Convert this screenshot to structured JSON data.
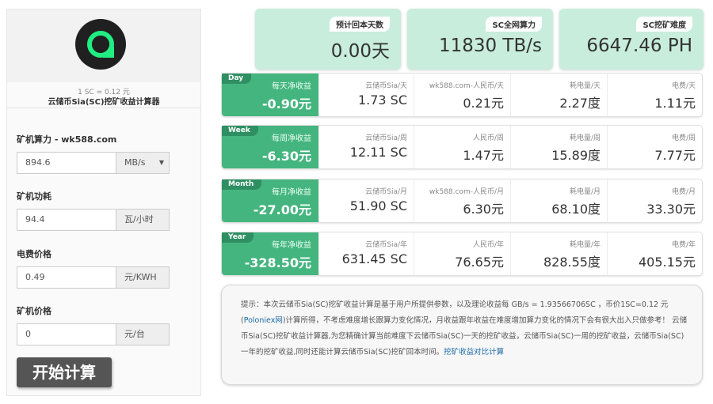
{
  "sidebar": {
    "rate": "1 SC = 0.12 元",
    "title": "云储币Sia(SC)挖矿收益计算器",
    "hashrate": {
      "label": "矿机算力 - wk588.com",
      "value": "894.6",
      "unit": "MB/s"
    },
    "power": {
      "label": "矿机功耗",
      "value": "94.4",
      "unit": "瓦/小时"
    },
    "electricity": {
      "label": "电费价格",
      "value": "0.49",
      "unit": "元/KWH"
    },
    "price": {
      "label": "矿机价格",
      "value": "0",
      "unit": "元/台"
    },
    "start_label": "开始计算"
  },
  "stats": [
    {
      "tag": "预计回本天数",
      "value": "0.00天"
    },
    {
      "tag": "SC全网算力",
      "value": "11830 TB/s"
    },
    {
      "tag": "SC挖矿难度",
      "value": "6647.46 PH"
    }
  ],
  "rows": [
    {
      "period": "Day",
      "net_label": "每天净收益",
      "net_value": "-0.90元",
      "cells": [
        {
          "label": "云储币Sia/天",
          "value": "1.73 SC"
        },
        {
          "label": "wk588.com-人民币/天",
          "value": "0.21元"
        },
        {
          "label": "耗电量/天",
          "value": "2.27度"
        },
        {
          "label": "电费/天",
          "value": "1.11元"
        }
      ]
    },
    {
      "period": "Week",
      "net_label": "每周净收益",
      "net_value": "-6.30元",
      "cells": [
        {
          "label": "云储币Sia/周",
          "value": "12.11 SC"
        },
        {
          "label": "人民币/周",
          "value": "1.47元"
        },
        {
          "label": "耗电量/周",
          "value": "15.89度"
        },
        {
          "label": "电费/周",
          "value": "7.77元"
        }
      ]
    },
    {
      "period": "Month",
      "net_label": "每月净收益",
      "net_value": "-27.00元",
      "cells": [
        {
          "label": "云储币Sia/月",
          "value": "51.90 SC"
        },
        {
          "label": "wk588.com-人民币/月",
          "value": "6.30元"
        },
        {
          "label": "耗电量/月",
          "value": "68.10度"
        },
        {
          "label": "电费/月",
          "value": "33.30元"
        }
      ]
    },
    {
      "period": "Year",
      "net_label": "每年净收益",
      "net_value": "-328.50元",
      "cells": [
        {
          "label": "云储币Sia/年",
          "value": "631.45 SC"
        },
        {
          "label": "人民币/年",
          "value": "76.65元"
        },
        {
          "label": "耗电量/年",
          "value": "828.55度"
        },
        {
          "label": "电费/年",
          "value": "405.15元"
        }
      ]
    }
  ],
  "tip": {
    "text_1": "提示：本次云储币Sia(SC)挖矿收益计算是基于用户所提供参数，以及理论收益每 GB/s = 1.93566706SC ，币价1SC=0.12 元 (",
    "link_1": "Poloniex网",
    "text_2": ")计算所得，不考虑难度增长跟算力变化情况，月收益跟年收益在难度增加算力变化的情况下会有很大出入只做参考！ 云储币Sia(SC)挖矿收益计算器,为您精确计算当前难度下云储币Sia(SC)一天的挖矿收益，云储币Sia(SC)一周的挖矿收益，云储币Sia(SC)一年的挖矿收益,同时还能计算云储币Sia(SC)挖矿回本时间。",
    "link_2": "挖矿收益对比计算"
  },
  "colors": {
    "accent": "#45b57f",
    "accent_dark": "#2e8f63",
    "card_bg": "#c8eddd",
    "logo_green": "#20ee82",
    "button": "#555555"
  }
}
